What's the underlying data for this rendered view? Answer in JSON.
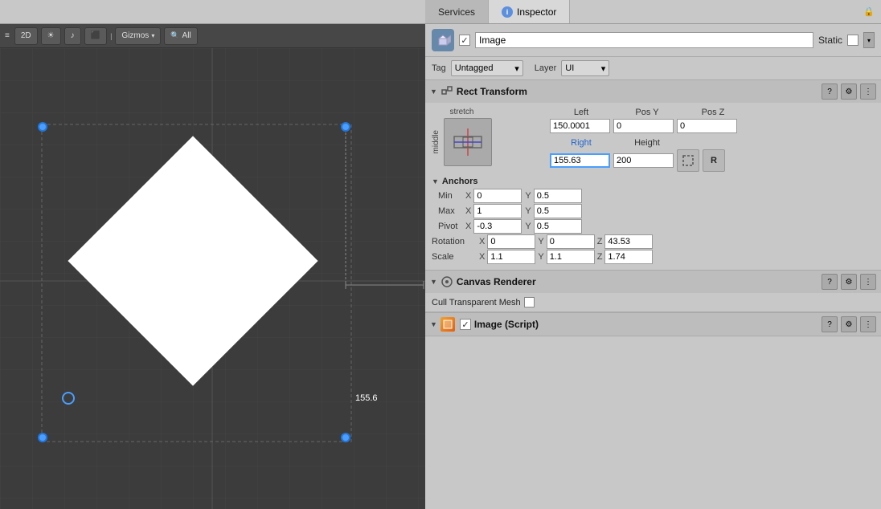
{
  "tabs": {
    "services_label": "Services",
    "inspector_label": "Inspector",
    "info_icon": "i"
  },
  "toolbar": {
    "mode_label": "2D",
    "sun_icon": "☀",
    "audio_icon": "♪",
    "image_icon": "🖼",
    "gizmos_label": "Gizmos",
    "all_label": "All",
    "dropdown_arrow": "▾"
  },
  "scene": {
    "value_label": "155.6"
  },
  "inspector": {
    "checkbox_check": "✓",
    "object_name": "Image",
    "static_label": "Static",
    "tag_label": "Tag",
    "tag_value": "Untagged",
    "layer_label": "Layer",
    "layer_value": "UI",
    "rect_transform": {
      "title": "Rect Transform",
      "stretch_label": "stretch",
      "middle_label": "middle",
      "left_label": "Left",
      "pos_y_label": "Pos Y",
      "pos_z_label": "Pos Z",
      "left_value": "150.0001",
      "pos_y_value": "0",
      "pos_z_value": "0",
      "right_label": "Right",
      "height_label": "Height",
      "right_value": "155.63",
      "height_value": "200",
      "r_btn_label": "R",
      "anchors_title": "Anchors",
      "min_label": "Min",
      "min_x": "0",
      "min_y": "0.5",
      "max_label": "Max",
      "max_x": "1",
      "max_y": "0.5",
      "pivot_label": "Pivot",
      "pivot_x": "-0.3",
      "pivot_y": "0.5",
      "rotation_label": "Rotation",
      "rot_x": "0",
      "rot_y": "0",
      "rot_z": "43.53",
      "scale_label": "Scale",
      "scale_x": "1.1",
      "scale_y": "1.1",
      "scale_z": "1.74"
    },
    "canvas_renderer": {
      "title": "Canvas Renderer",
      "cull_label": "Cull Transparent Mesh"
    },
    "image_script": {
      "title": "Image (Script)"
    }
  }
}
